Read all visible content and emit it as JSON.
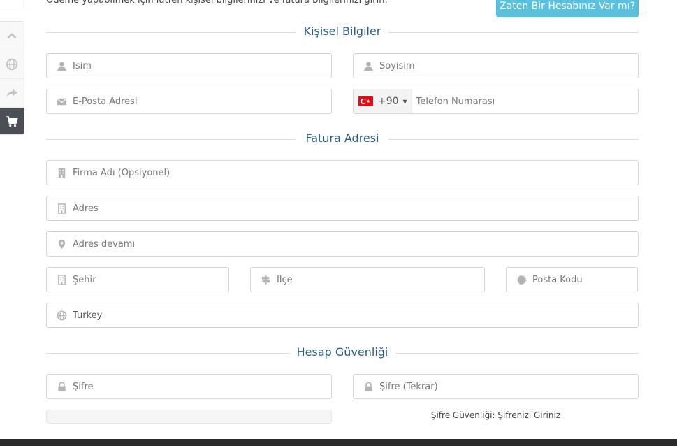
{
  "intro": {
    "text": "Ödeme yapabilmek için lütfen kişisel bilgilerinizi ve fatura bilgilerinizi girin.",
    "login_button": "Zaten Bir Hesabınız Var mı?"
  },
  "sidebar_tools": [
    "chevron-up-icon",
    "globe-icon",
    "share-icon",
    "cart-icon"
  ],
  "sections": {
    "personal": "Kişisel Bilgiler",
    "billing": "Fatura Adresi",
    "security": "Hesap Güvenliği"
  },
  "fields": {
    "first_name": {
      "placeholder": "İsim",
      "value": ""
    },
    "last_name": {
      "placeholder": "Soyisim",
      "value": ""
    },
    "email": {
      "placeholder": "E-Posta Adresi",
      "value": ""
    },
    "phone": {
      "dial_code": "+90",
      "placeholder": "Telefon Numarası",
      "value": ""
    },
    "company": {
      "placeholder": "Firma Adı (Opsiyonel)",
      "value": ""
    },
    "address1": {
      "placeholder": "Adres",
      "value": ""
    },
    "address2": {
      "placeholder": "Adres devamı",
      "value": ""
    },
    "city": {
      "placeholder": "Şehir",
      "value": ""
    },
    "district": {
      "placeholder": "İlçe",
      "value": ""
    },
    "postcode": {
      "placeholder": "Posta Kodu",
      "value": ""
    },
    "country": {
      "value": "Turkey"
    },
    "password": {
      "placeholder": "Şifre",
      "value": ""
    },
    "password_confirm": {
      "placeholder": "Şifre (Tekrar)",
      "value": ""
    }
  },
  "password_strength": {
    "text": "Şifre Güvenliği: Şifrenizi Giriniz",
    "level": 0
  },
  "colors": {
    "accent": "#2a5c8a",
    "login_button": "#5bc0de",
    "icon": "#b3b3b3"
  }
}
